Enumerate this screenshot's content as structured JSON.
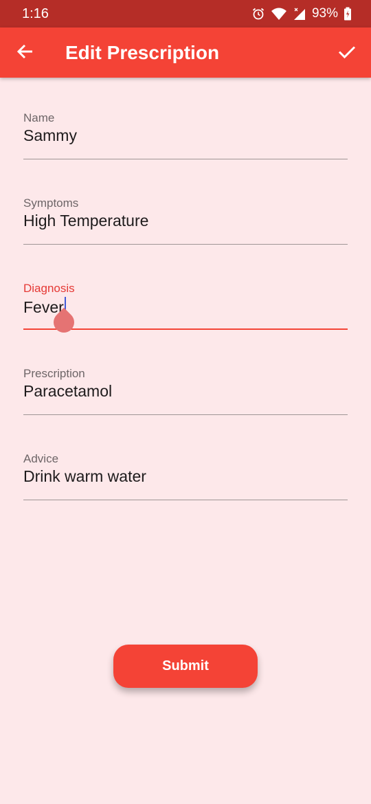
{
  "status_bar": {
    "time": "1:16",
    "battery_percent": "93%",
    "icons": [
      "alarm-icon",
      "wifi-icon",
      "signal-icon",
      "battery-icon"
    ]
  },
  "app_bar": {
    "title": "Edit Prescription",
    "back_icon": "arrow-left-icon",
    "confirm_icon": "check-icon",
    "color": "#f44336"
  },
  "form": {
    "name": {
      "label": "Name",
      "value": "Sammy"
    },
    "symptoms": {
      "label": "Symptoms",
      "value": "High Temperature"
    },
    "diagnosis": {
      "label": "Diagnosis",
      "value": "Fever"
    },
    "prescription": {
      "label": "Prescription",
      "value": "Paracetamol"
    },
    "advice": {
      "label": "Advice",
      "value": "Drink warm water"
    }
  },
  "submit_label": "Submit",
  "colors": {
    "accent": "#f44336",
    "status_bar": "#b52d27",
    "background": "#fde8ea",
    "focused_label": "#e53935"
  }
}
